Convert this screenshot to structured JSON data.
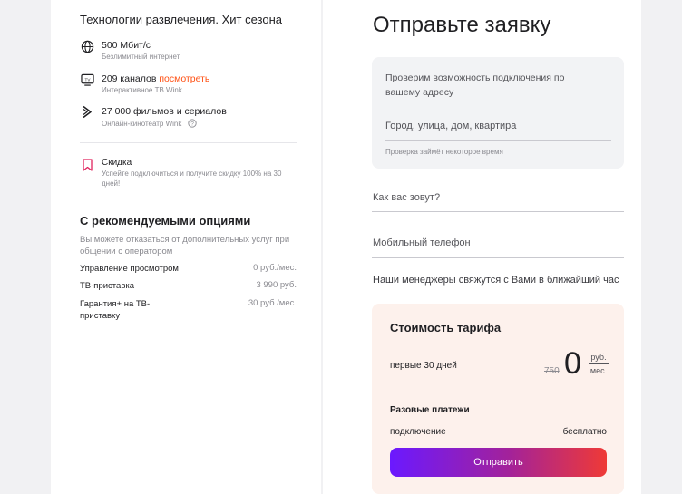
{
  "left": {
    "title": "Технологии развлечения. Хит сезона",
    "features": [
      {
        "icon": "globe-icon",
        "main": "500 Мбит/с",
        "sub": "Безлимитный интернет"
      },
      {
        "icon": "tv-icon",
        "main": "209 каналов",
        "link": "посмотреть",
        "sub": "Интерактивное ТВ Wink"
      },
      {
        "icon": "wink-icon",
        "main": "27 000 фильмов и сериалов",
        "sub": "Онлайн-кинотеатр Wink"
      }
    ],
    "discount": {
      "icon": "bookmark-icon",
      "title": "Скидка",
      "sub1": "Успейте подключиться и получите скидку 100% на 30",
      "sub2": "дней!"
    },
    "options": {
      "title": "С рекомендуемыми опциями",
      "note1": "Вы можете отказаться от дополнительных услуг при",
      "note2": "общении с оператором",
      "rows": [
        {
          "name": "Управление просмотром",
          "price": "0 руб./мес."
        },
        {
          "name": "ТВ-приставка",
          "price": "3 990 руб."
        },
        {
          "name1": "Гарантия+ на ТВ-",
          "name2": "приставку",
          "price": "30 руб./мес."
        }
      ]
    }
  },
  "right": {
    "title": "Отправьте заявку",
    "address": {
      "line1": "Проверим возможность подключения по",
      "line2": "вашему адресу",
      "placeholder": "Город, улица, дом, квартира",
      "hint": "Проверка займёт некоторое время"
    },
    "name_placeholder": "Как вас зовут?",
    "phone_placeholder": "Мобильный телефон",
    "managers_note": "Наши менеджеры свяжутся с Вами в ближайший час",
    "cost": {
      "title": "Стоимость тарифа",
      "period": "первые 30 дней",
      "old_price": "750",
      "price": "0",
      "unit_top": "руб.",
      "unit_bottom": "мес.",
      "one_time_title": "Разовые платежи",
      "connect_label": "подключение",
      "connect_value": "бесплатно",
      "submit": "Отправить"
    }
  },
  "colors": {
    "accent_orange": "#ff4f12",
    "grad_start": "#6b19ff",
    "grad_end": "#ef3a36"
  }
}
